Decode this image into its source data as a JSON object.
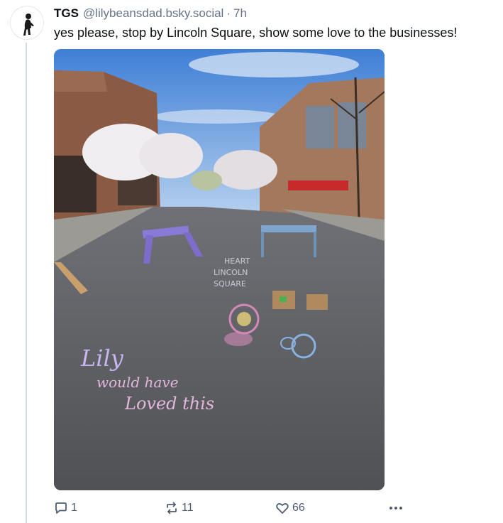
{
  "post": {
    "author": {
      "display_name": "TGS",
      "handle": "@lilybeansdad.bsky.social",
      "separator": "·",
      "time": "7h"
    },
    "text": "yes please, stop by Lincoln Square, show some love to the businesses!",
    "image": {
      "chalk_lines": [
        "HEART",
        "LINCOLN",
        "SQUARE"
      ],
      "chalk_message": [
        "Lily",
        "would have",
        "Loved this"
      ]
    },
    "actions": {
      "reply": {
        "icon": "reply-icon",
        "count": "1"
      },
      "repost": {
        "icon": "repost-icon",
        "count": "11"
      },
      "like": {
        "icon": "heart-icon",
        "count": "66"
      },
      "more": {
        "icon": "more-dots-icon"
      }
    },
    "colors": {
      "text": "#0b0f14",
      "muted": "#66758a",
      "action": "#4e5d72",
      "thread": "#d4dbe2"
    }
  }
}
